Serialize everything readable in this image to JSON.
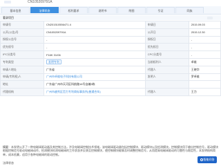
{
  "header": {
    "pub_no": "CN105209791A"
  },
  "tabs": [
    {
      "label": "基本信息",
      "active": false
    },
    {
      "label": "法律状态",
      "active": true
    },
    {
      "label": "权利要求",
      "active": false
    },
    {
      "label": "说明书",
      "active": false
    },
    {
      "label": "附图",
      "active": false
    },
    {
      "label": "引证",
      "active": false
    },
    {
      "label": "同族",
      "active": false
    }
  ],
  "section": {
    "title": "著录项目"
  },
  "rows": [
    {
      "l1": "申请号",
      "v1": "CN201510556471.4",
      "l2": "申请日",
      "v2": "2015.09.03"
    },
    {
      "l1": "公开(公告)号",
      "v1": "CN105209791A",
      "l2": "公开日",
      "v2": "2015.12.30"
    },
    {
      "l1": "授权公告号",
      "v1": "-",
      "l2": "授权日",
      "v2": "-"
    },
    {
      "l1": "优先权号",
      "v1": "-",
      "l2": "优先权日",
      "v2": "-"
    },
    {
      "l1": "IPC分类号",
      "v1": "F16K 31/06",
      "l2": "CPC分类号",
      "v2": "-"
    },
    {
      "l1": "专利类型",
      "v1": "发明专利",
      "l2": "当前权利人",
      "v2": "卓维"
    },
    {
      "l1": "申请人地址",
      "v1": "广东省",
      "l2": "代理人",
      "v2": "王晓华"
    },
    {
      "l1": "申请(专利权)人",
      "v1": "广州市卓维电子科技有限公司",
      "l2": "发明人",
      "v2": "罗卓维"
    },
    {
      "l1": "地址",
      "v1": "广东省广州市天河区科韵路16号自编3栋",
      "l2": "",
      "v2": ""
    },
    {
      "l1": "代理机构",
      "v1": "广州市越秀区哲力专利商标事务所(普通合伙)",
      "l2": "代理人",
      "v2": "王力"
    }
  ],
  "abstract": {
    "label": "摘要",
    "text": "本发明公开了一种电磁阀驱动器及其控制方法，涉及电磁阀控制技术领域，该电磁阀驱动器包括控制模块、驱动模块以及检测模块，控制模块用于输出控制信号，驱动模块根据控制信号驱动电磁阀动作，检测模块检测电磁阀的工作状态并反馈至控制模块，使控制模块能够及时调整控制信号，从而提高电磁阀驱动的可靠性与稳定性，本发明结构简单，成本低廉，适用于各种电磁阀的驱动控制。"
  },
  "bottom": {
    "title": "法律状态"
  },
  "fab": {
    "label": "智能问答"
  }
}
